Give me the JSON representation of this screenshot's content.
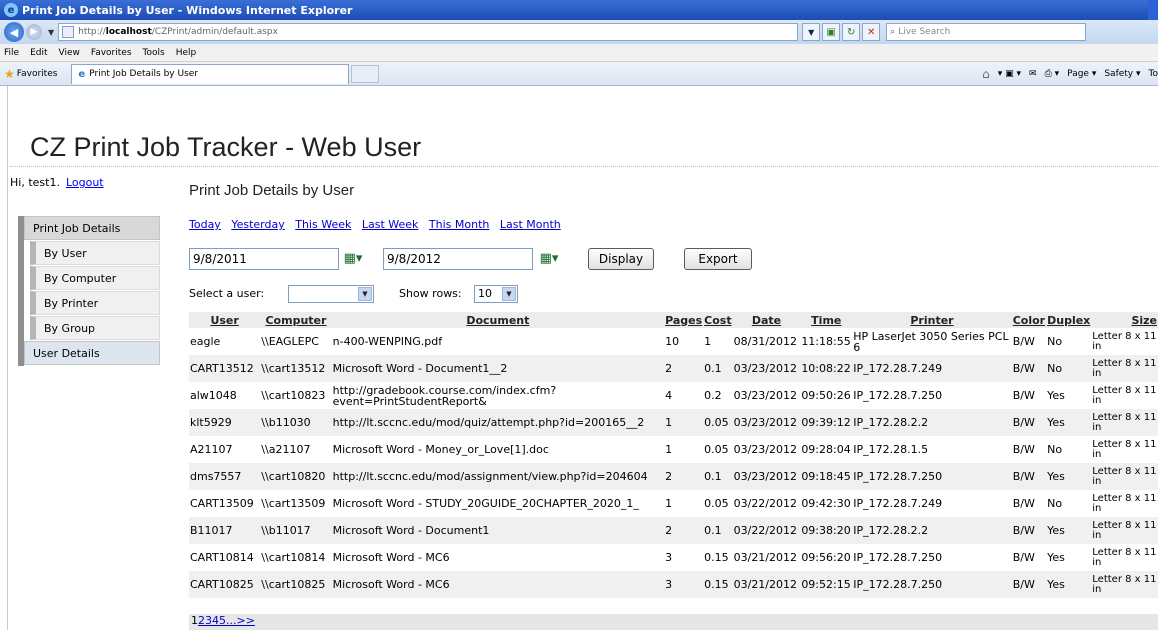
{
  "browser": {
    "window_title": "Print Job Details by User - Windows Internet Explorer",
    "url_prefix": "http://",
    "url_host": "localhost",
    "url_path": "/CZPrint/admin/default.aspx",
    "search_placeholder": "Live Search",
    "menu": [
      "File",
      "Edit",
      "View",
      "Favorites",
      "Tools",
      "Help"
    ],
    "favorites_label": "Favorites",
    "tab_title": "Print Job Details by User",
    "commands": [
      "Page ▾",
      "Safety ▾",
      "To"
    ]
  },
  "app": {
    "title": "CZ Print Job Tracker - Web User",
    "greeting": "Hi, test1.",
    "logout": "Logout"
  },
  "nav": {
    "print_job_details": "Print Job Details",
    "by_user": "By User",
    "by_computer": "By Computer",
    "by_printer": "By Printer",
    "by_group": "By Group",
    "user_details": "User Details"
  },
  "main": {
    "section_title": "Print Job Details by User",
    "quick_links": [
      "Today",
      "Yesterday",
      "This Week",
      "Last Week",
      "This Month",
      "Last Month"
    ],
    "start_date": "9/8/2011",
    "end_date": "9/8/2012",
    "display_label": "Display",
    "export_label": "Export",
    "select_user_label": "Select a user:",
    "select_user_value": "",
    "show_rows_label": "Show rows:",
    "show_rows_value": "10"
  },
  "table": {
    "headers": [
      "User",
      "Computer",
      "Document",
      "Pages",
      "Cost",
      "Date",
      "Time",
      "Printer",
      "Color",
      "Duplex",
      "Size"
    ],
    "rows": [
      [
        "eagle",
        "\\\\EAGLEPC",
        "n-400-WENPING.pdf",
        "10",
        "1",
        "08/31/2012",
        "11:18:55",
        "HP LaserJet 3050 Series PCL 6",
        "B/W",
        "No",
        "Letter 8 x 11 in"
      ],
      [
        "CART13512",
        "\\\\cart13512",
        "Microsoft Word - Document1__2",
        "2",
        "0.1",
        "03/23/2012",
        "10:08:22",
        "IP_172.28.7.249",
        "B/W",
        "No",
        "Letter 8 x 11 in"
      ],
      [
        "alw1048",
        "\\\\cart10823",
        "http://gradebook.course.com/index.cfm?event=PrintStudentReport&",
        "4",
        "0.2",
        "03/23/2012",
        "09:50:26",
        "IP_172.28.7.250",
        "B/W",
        "Yes",
        "Letter 8 x 11 in"
      ],
      [
        "klt5929",
        "\\\\b11030",
        "http://lt.sccnc.edu/mod/quiz/attempt.php?id=200165__2",
        "1",
        "0.05",
        "03/23/2012",
        "09:39:12",
        "IP_172.28.2.2",
        "B/W",
        "Yes",
        "Letter 8 x 11 in"
      ],
      [
        "A21107",
        "\\\\a21107",
        "Microsoft Word - Money_or_Love[1].doc",
        "1",
        "0.05",
        "03/23/2012",
        "09:28:04",
        "IP_172.28.1.5",
        "B/W",
        "No",
        "Letter 8 x 11 in"
      ],
      [
        "dms7557",
        "\\\\cart10820",
        "http://lt.sccnc.edu/mod/assignment/view.php?id=204604",
        "2",
        "0.1",
        "03/23/2012",
        "09:18:45",
        "IP_172.28.7.250",
        "B/W",
        "Yes",
        "Letter 8 x 11 in"
      ],
      [
        "CART13509",
        "\\\\cart13509",
        "Microsoft Word - STUDY_20GUIDE_20CHAPTER_2020_1_",
        "1",
        "0.05",
        "03/22/2012",
        "09:42:30",
        "IP_172.28.7.249",
        "B/W",
        "No",
        "Letter 8 x 11 in"
      ],
      [
        "B11017",
        "\\\\b11017",
        "Microsoft Word - Document1",
        "2",
        "0.1",
        "03/22/2012",
        "09:38:20",
        "IP_172.28.2.2",
        "B/W",
        "Yes",
        "Letter 8 x 11 in"
      ],
      [
        "CART10814",
        "\\\\cart10814",
        "Microsoft Word - MC6",
        "3",
        "0.15",
        "03/21/2012",
        "09:56:20",
        "IP_172.28.7.250",
        "B/W",
        "Yes",
        "Letter 8 x 11 in"
      ],
      [
        "CART10825",
        "\\\\cart10825",
        "Microsoft Word - MC6",
        "3",
        "0.15",
        "03/21/2012",
        "09:52:15",
        "IP_172.28.7.250",
        "B/W",
        "Yes",
        "Letter 8 x 11 in"
      ]
    ]
  },
  "pager": {
    "current": "1",
    "pages": [
      "2",
      "3",
      "4",
      "5",
      "...",
      ">>"
    ]
  }
}
